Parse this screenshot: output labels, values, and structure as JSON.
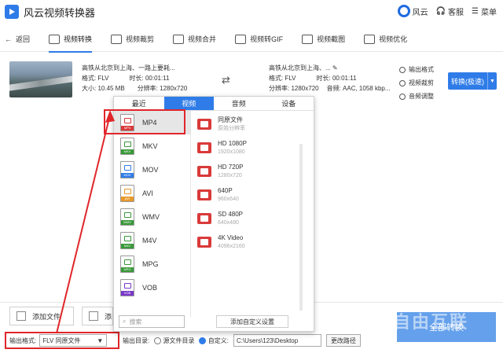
{
  "app": {
    "title": "风云视频转换器",
    "right": [
      "风云",
      "客服",
      "菜单"
    ]
  },
  "toolbar": {
    "back": "返回",
    "items": [
      "视频转换",
      "视频裁剪",
      "视频合并",
      "视频转GIF",
      "视频截图",
      "视频优化"
    ]
  },
  "file": {
    "src_name": "高铁从北京到上海、一路上要耗...",
    "src_format": "格式: FLV",
    "src_duration": "时长: 00:01:11",
    "src_size": "大小: 10.45 MB",
    "src_resolution": "分辨率: 1280x720",
    "dst_name": "高铁从北京到上海、...",
    "dst_format": "格式: FLV",
    "dst_duration": "时长: 00:01:11",
    "dst_resolution": "分辨率: 1280x720",
    "dst_audio": "音频: AAC, 1058 kbp..."
  },
  "side_actions": [
    "输出格式",
    "视频裁剪",
    "音频调整"
  ],
  "convert_button": "转换(极速)",
  "popup": {
    "tabs": [
      "最近",
      "视频",
      "音频",
      "设备"
    ],
    "formats": [
      "MP4",
      "MKV",
      "MOV",
      "AVI",
      "WMV",
      "M4V",
      "MPG",
      "VOB"
    ],
    "format_colors": [
      "#d93a3a",
      "#3a9a3a",
      "#2f7ce8",
      "#e89a2a",
      "#3a9a3a",
      "#3a9a3a",
      "#3a9a3a",
      "#7a3ac9"
    ],
    "resolutions": [
      {
        "name": "同原文件",
        "detail": "原始分辨率"
      },
      {
        "name": "HD 1080P",
        "detail": "1920x1080"
      },
      {
        "name": "HD 720P",
        "detail": "1280x720"
      },
      {
        "name": "640P",
        "detail": "960x640"
      },
      {
        "name": "SD 480P",
        "detail": "640x480"
      },
      {
        "name": "4K Video",
        "detail": "4096x2160"
      }
    ],
    "search_placeholder": "搜索",
    "custom_button": "添加自定义设置"
  },
  "bottom": {
    "add_file": "添加文件",
    "add_folder": "添",
    "output_format_label": "输出格式:",
    "output_format_value": "FLV 同原文件",
    "output_dir_label": "输出目录:",
    "source_dir": "源文件目录",
    "custom": "自定义:",
    "path": "C:\\Users\\123\\Desktop",
    "change_path": "更改路径",
    "convert_all": "全部转换"
  },
  "watermark": "自由互联"
}
